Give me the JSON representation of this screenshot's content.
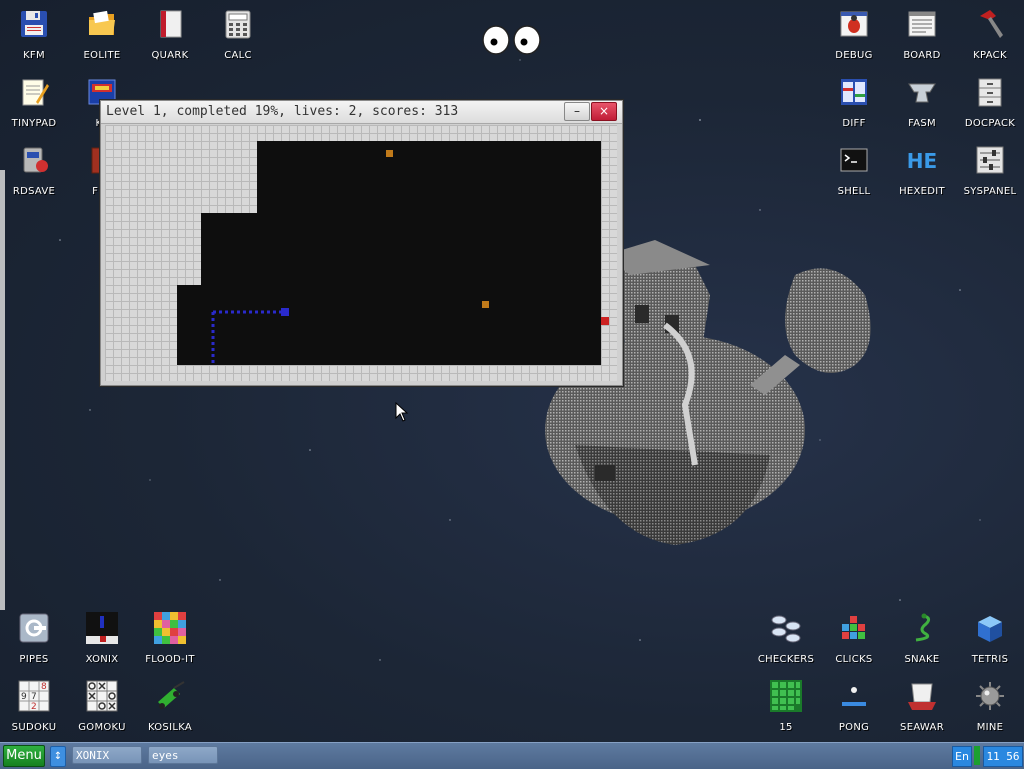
{
  "desktop_icons": {
    "kfm": {
      "label": "KFM",
      "icon": "floppy-icon"
    },
    "eolite": {
      "label": "EOLITE",
      "icon": "folder-icon"
    },
    "quark": {
      "label": "QUARK",
      "icon": "book-icon"
    },
    "calc": {
      "label": "CALC",
      "icon": "calculator-icon"
    },
    "tinypad": {
      "label": "TINYPAD",
      "icon": "notepad-icon"
    },
    "kf": {
      "label": "KF",
      "icon": "kf-icon"
    },
    "rdsave": {
      "label": "RDSAVE",
      "icon": "rdsave-icon"
    },
    "fb2": {
      "label": "FB2",
      "icon": "fb2-book-icon"
    },
    "debug": {
      "label": "DEBUG",
      "icon": "bug-icon"
    },
    "board": {
      "label": "BOARD",
      "icon": "board-icon"
    },
    "kpack": {
      "label": "KPACK",
      "icon": "hammer-icon"
    },
    "diff": {
      "label": "DIFF",
      "icon": "diff-icon"
    },
    "fasm": {
      "label": "FASM",
      "icon": "anvil-icon"
    },
    "docpack": {
      "label": "DOCPACK",
      "icon": "cabinet-icon"
    },
    "shell": {
      "label": "SHELL",
      "icon": "terminal-icon"
    },
    "hexedit": {
      "label": "HEXEDIT",
      "icon": "hex-icon",
      "icon_text": "HE"
    },
    "syspanel": {
      "label": "SYSPANEL",
      "icon": "sliders-icon"
    },
    "pipes": {
      "label": "PIPES",
      "icon": "pipes-icon"
    },
    "xonix": {
      "label": "XONIX",
      "icon": "xonix-icon"
    },
    "floodit": {
      "label": "FLOOD-IT",
      "icon": "color-grid-icon"
    },
    "sudoku": {
      "label": "SUDOKU",
      "icon": "sudoku-icon",
      "icon_text": [
        "9",
        "7",
        "8",
        "2"
      ]
    },
    "gomoku": {
      "label": "GOMOKU",
      "icon": "tic-tac-toe-icon"
    },
    "kosilka": {
      "label": "KOSILKA",
      "icon": "lawnmower-icon"
    },
    "checkers": {
      "label": "CHECKERS",
      "icon": "checkers-icon"
    },
    "clicks": {
      "label": "CLICKS",
      "icon": "blocks-icon"
    },
    "snake": {
      "label": "SNAKE",
      "icon": "snake-icon"
    },
    "tetris": {
      "label": "TETRIS",
      "icon": "tetris-cube-icon"
    },
    "fifteen": {
      "label": "15",
      "icon": "grid-15-icon"
    },
    "pong": {
      "label": "PONG",
      "icon": "pong-icon"
    },
    "seawar": {
      "label": "SEAWAR",
      "icon": "ship-icon"
    },
    "mine": {
      "label": "MINE",
      "icon": "mine-icon"
    }
  },
  "game_window": {
    "title": "Level 1, completed 19%, lives: 2, scores: 313",
    "minimize_label": "–",
    "close_label": "×",
    "completed_pct": 19,
    "lives": 2,
    "score": 313
  },
  "taskbar": {
    "menu_label": "Menu",
    "switch_label": "↕",
    "tasks": [
      {
        "label": "XONIX"
      },
      {
        "label": "eyes"
      }
    ],
    "lang": "En",
    "clock": "11 56"
  },
  "colors": {
    "desktop_bg": "#1c2636",
    "menu_green": "#1c9a2c",
    "snake_blue": "#2222cc",
    "enemy_orange": "#c07a1a",
    "enemy_red": "#cc2222",
    "taskbar": "#5573a0"
  }
}
